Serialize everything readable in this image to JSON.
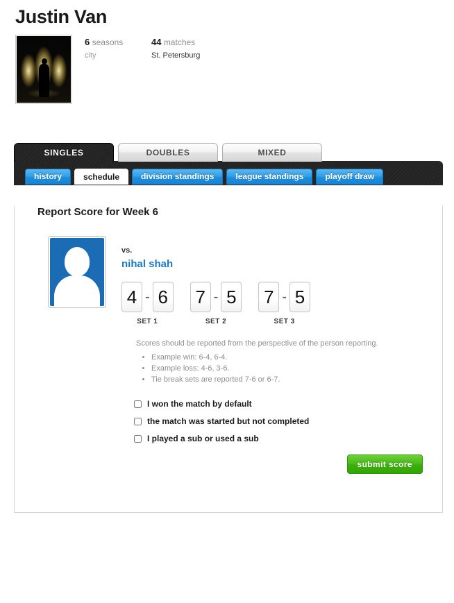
{
  "profile": {
    "name": "Justin Van",
    "photo_alt": "player-photo",
    "stats": [
      {
        "value": "6",
        "unit": "seasons",
        "detail_label": "city",
        "detail_dark": false
      },
      {
        "value": "44",
        "unit": "matches",
        "detail_label": "St. Petersburg",
        "detail_dark": true
      }
    ]
  },
  "primary_tabs": [
    {
      "label": "SINGLES",
      "active": true
    },
    {
      "label": "DOUBLES",
      "active": false
    },
    {
      "label": "MIXED",
      "active": false
    }
  ],
  "secondary_tabs": [
    {
      "label": "history",
      "active": false
    },
    {
      "label": "schedule",
      "active": true
    },
    {
      "label": "division standings",
      "active": false
    },
    {
      "label": "league standings",
      "active": false
    },
    {
      "label": "playoff draw",
      "active": false
    }
  ],
  "report": {
    "title": "Report Score for Week 6",
    "vs_label": "vs.",
    "opponent": "nihal shah",
    "sets": [
      {
        "label": "SET 1",
        "mine": "4",
        "theirs": "6",
        "dash": "-"
      },
      {
        "label": "SET 2",
        "mine": "7",
        "theirs": "5",
        "dash": "-"
      },
      {
        "label": "SET 3",
        "mine": "7",
        "theirs": "5",
        "dash": "-"
      }
    ],
    "help_lead": "Scores should be reported from the perspective of the person reporting.",
    "help_items": [
      "Example win: 6-4, 6-4.",
      "Example loss: 4-6, 3-6.",
      "Tie break sets are reported 7-6 or 6-7."
    ],
    "options": [
      {
        "label": "I won the match by default",
        "checked": false
      },
      {
        "label": "the match was started but not completed",
        "checked": false
      },
      {
        "label": "I played a sub or used a sub",
        "checked": false
      }
    ],
    "submit_label": "submit score"
  },
  "colors": {
    "tab_blue": "#1e8ddb",
    "link_blue": "#1a7bc4",
    "submit_green": "#3bb00c",
    "dark_bar": "#232323",
    "avatar_blue": "#1c6cb5"
  }
}
